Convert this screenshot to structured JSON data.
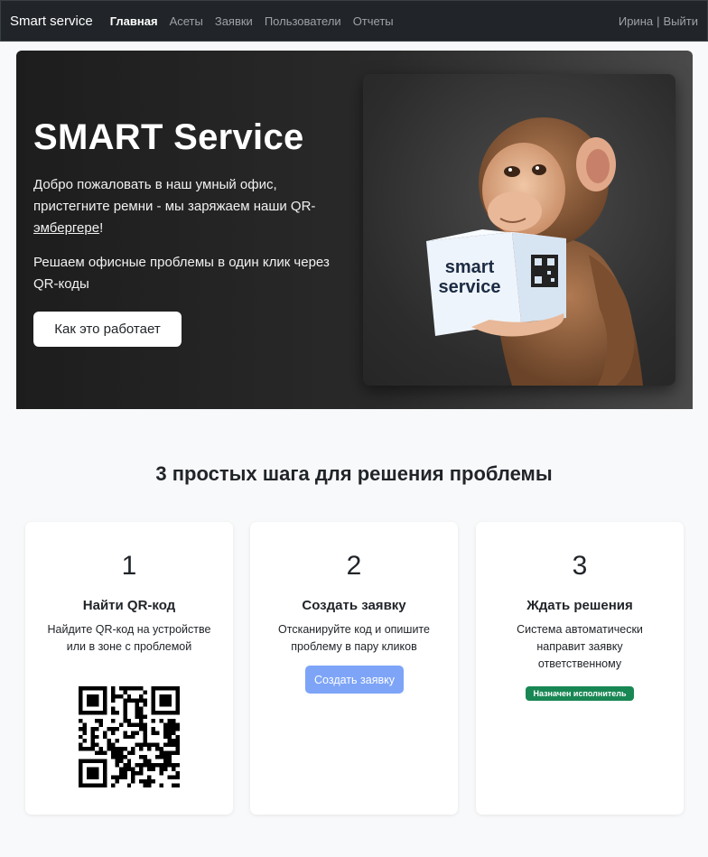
{
  "navbar": {
    "brand": "Smart service",
    "links": [
      "Главная",
      "Асеты",
      "Заявки",
      "Пользователи",
      "Отчеты"
    ],
    "user": "Ирина",
    "separator": "|",
    "logout": "Выйти"
  },
  "hero": {
    "title": "SMART Service",
    "text1_part1": "Добро пожаловать в наш умный офис, пристегните ремни - мы заряжаем наши QR-",
    "text1_link": "эмбергере",
    "text1_end": "!",
    "text2": "Решаем офисные проблемы в один клик через QR-коды",
    "button": "Как это работает",
    "image_caption_line1": "smart",
    "image_caption_line2": "service"
  },
  "steps": {
    "title": "3 простых шага для решения проблемы",
    "cards": [
      {
        "num": "1",
        "title": "Найти QR-код",
        "text": "Найдите QR-код на устройстве или в зоне с проблемой"
      },
      {
        "num": "2",
        "title": "Создать заявку",
        "text": "Отсканируйте код и опишите проблему в пару кликов",
        "button": "Создать заявку"
      },
      {
        "num": "3",
        "title": "Ждать решения",
        "text": "Система автоматически направит заявку ответственному",
        "badge": "Назначен исполнитель"
      }
    ]
  },
  "colors": {
    "navbar_bg": "#212529",
    "primary_soft": "#7da4f7",
    "success": "#198754"
  }
}
